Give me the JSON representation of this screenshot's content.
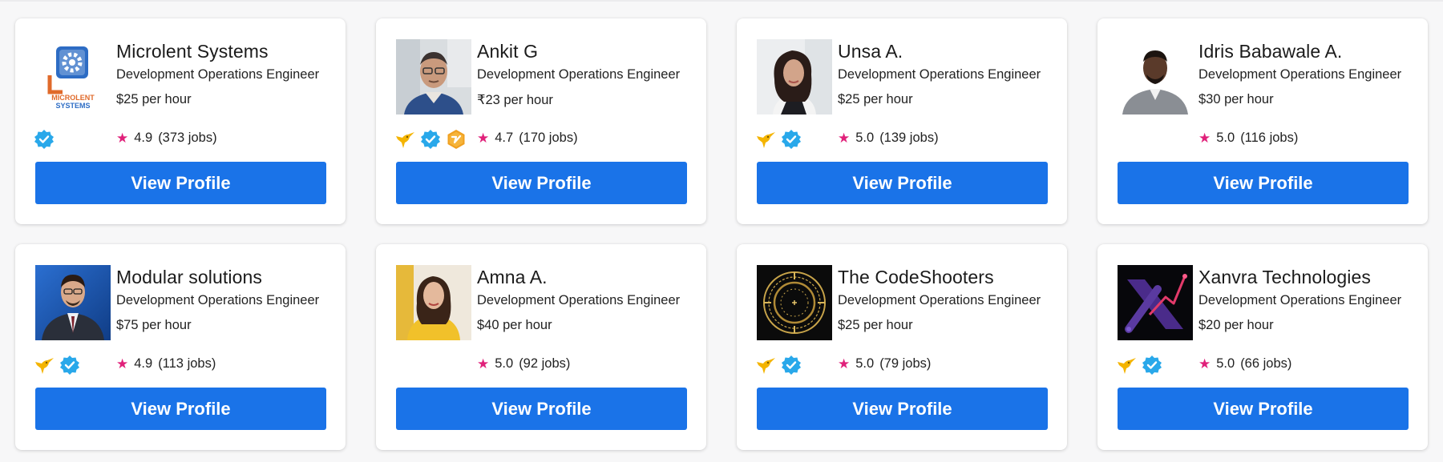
{
  "colors": {
    "accent": "#1a73e8",
    "star": "#e0217a",
    "verified": "#29a8ea",
    "pro": "#f0a020",
    "topRated": "#f4b400"
  },
  "cards": [
    {
      "name": "Microlent Systems",
      "role": "Development Operations Engineer",
      "rate": "$25 per hour",
      "rating": "4.9",
      "jobs": "(373 jobs)",
      "button": "View Profile",
      "badges": [
        "verified-badge-icon"
      ],
      "avatar": "microlent-logo",
      "logo_text": "MICROLENT SYSTEMS"
    },
    {
      "name": "Ankit G",
      "role": "Development Operations Engineer",
      "rate": "₹23 per hour",
      "rating": "4.7",
      "jobs": "(170 jobs)",
      "button": "View Profile",
      "badges": [
        "hummingbird-icon",
        "verified-badge-icon",
        "pro-badge-icon"
      ],
      "avatar": "profile-photo"
    },
    {
      "name": "Unsa A.",
      "role": "Development Operations Engineer",
      "rate": "$25 per hour",
      "rating": "5.0",
      "jobs": "(139 jobs)",
      "button": "View Profile",
      "badges": [
        "hummingbird-icon",
        "verified-badge-icon"
      ],
      "avatar": "profile-photo"
    },
    {
      "name": "Idris Babawale A.",
      "role": "Development Operations Engineer",
      "rate": "$30 per hour",
      "rating": "5.0",
      "jobs": "(116 jobs)",
      "button": "View Profile",
      "badges": [],
      "avatar": "profile-photo"
    },
    {
      "name": "Modular solutions",
      "role": "Development Operations Engineer",
      "rate": "$75 per hour",
      "rating": "4.9",
      "jobs": "(113 jobs)",
      "button": "View Profile",
      "badges": [
        "hummingbird-icon",
        "verified-badge-icon"
      ],
      "avatar": "profile-photo"
    },
    {
      "name": "Amna A.",
      "role": "Development Operations Engineer",
      "rate": "$40 per hour",
      "rating": "5.0",
      "jobs": "(92 jobs)",
      "button": "View Profile",
      "badges": [],
      "avatar": "profile-photo"
    },
    {
      "name": "The CodeShooters",
      "role": "Development Operations Engineer",
      "rate": "$25 per hour",
      "rating": "5.0",
      "jobs": "(79 jobs)",
      "button": "View Profile",
      "badges": [
        "hummingbird-icon",
        "verified-badge-icon"
      ],
      "avatar": "codeshooters-logo"
    },
    {
      "name": "Xanvra Technologies",
      "role": "Development Operations Engineer",
      "rate": "$20 per hour",
      "rating": "5.0",
      "jobs": "(66 jobs)",
      "button": "View Profile",
      "badges": [
        "hummingbird-icon",
        "verified-badge-icon"
      ],
      "avatar": "xanvra-logo"
    }
  ]
}
